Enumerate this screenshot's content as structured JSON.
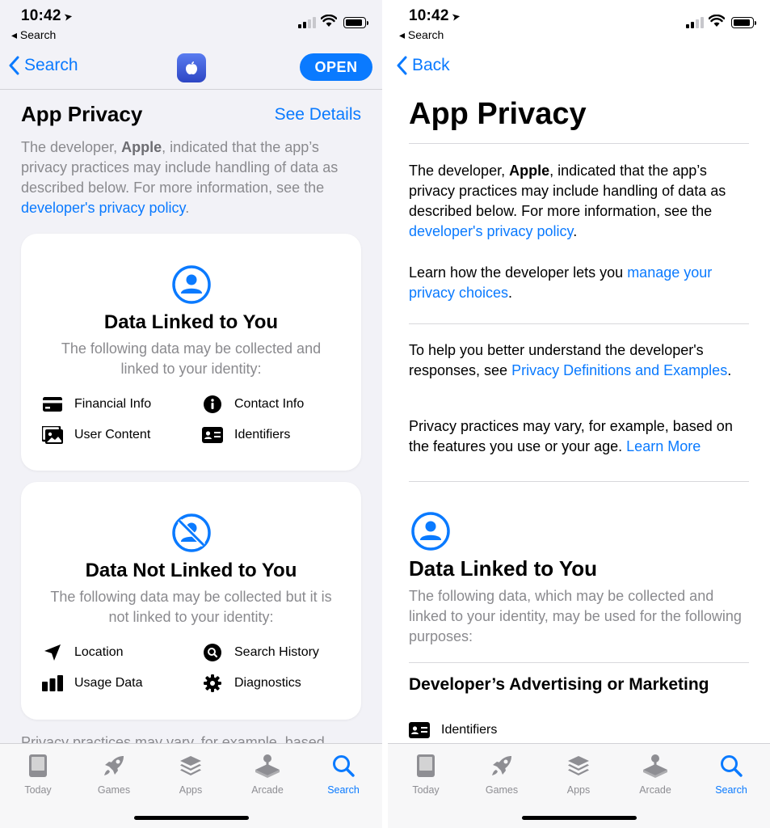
{
  "colors": {
    "accent": "#0a7aff",
    "secondary_text": "#8a8a8e",
    "background": "#f2f2f7"
  },
  "status": {
    "time": "10:42",
    "back_hint": "◂ Search"
  },
  "left": {
    "nav": {
      "back_label": "Search",
      "open_label": "OPEN"
    },
    "title": "App Privacy",
    "see_details": "See Details",
    "desc_1": "The developer, ",
    "desc_bold": "Apple",
    "desc_2": ", indicated that the app’s privacy practices may include handling of data as described below. For more information, see the ",
    "desc_link": "developer's privacy policy",
    "desc_end": ".",
    "cards": [
      {
        "icon": "person-circle-icon",
        "title": "Data Linked to You",
        "subtitle": "The following data may be collected and linked to your identity:",
        "items": [
          {
            "label": "Financial Info",
            "icon": "credit-card-icon"
          },
          {
            "label": "Contact Info",
            "icon": "info-circle-icon"
          },
          {
            "label": "User Content",
            "icon": "photo-icon"
          },
          {
            "label": "Identifiers",
            "icon": "id-card-icon"
          }
        ]
      },
      {
        "icon": "person-slash-icon",
        "title": "Data Not Linked to You",
        "subtitle": "The following data may be collected but it is not linked to your identity:",
        "items": [
          {
            "label": "Location",
            "icon": "location-arrow-icon"
          },
          {
            "label": "Search History",
            "icon": "search-circle-icon"
          },
          {
            "label": "Usage Data",
            "icon": "bar-chart-icon"
          },
          {
            "label": "Diagnostics",
            "icon": "gear-icon"
          }
        ]
      }
    ],
    "fade_text": "Privacy practices may vary, for example, based"
  },
  "right": {
    "nav": {
      "back_label": "Back"
    },
    "title": "App Privacy",
    "p1_1": "The developer, ",
    "p1_bold": "Apple",
    "p1_2": ", indicated that the app’s privacy practices may include handling of data as described below. For more information, see the ",
    "p1_link": "developer's privacy policy",
    "p1_end": ".",
    "p2_1": "Learn how the developer lets you ",
    "p2_link": "manage your privacy choices",
    "p2_end": ".",
    "p3_1": "To help you better understand the developer's responses, see ",
    "p3_link": "Privacy Definitions and Examples",
    "p3_end": ".",
    "p4_1": "Privacy practices may vary, for example, based on the features you use or your age. ",
    "p4_link": "Learn More",
    "section_title": "Data Linked to You",
    "section_sub": "The following data, which may be collected and linked to your identity, may be used for the following purposes:",
    "purpose_title": "Developer’s Advertising or Marketing",
    "purpose_item": "Identifiers"
  },
  "tabs": [
    {
      "label": "Today",
      "icon": "today-icon",
      "active": false
    },
    {
      "label": "Games",
      "icon": "rocket-icon",
      "active": false
    },
    {
      "label": "Apps",
      "icon": "stack-icon",
      "active": false
    },
    {
      "label": "Arcade",
      "icon": "joystick-icon",
      "active": false
    },
    {
      "label": "Search",
      "icon": "search-icon",
      "active": true
    }
  ]
}
